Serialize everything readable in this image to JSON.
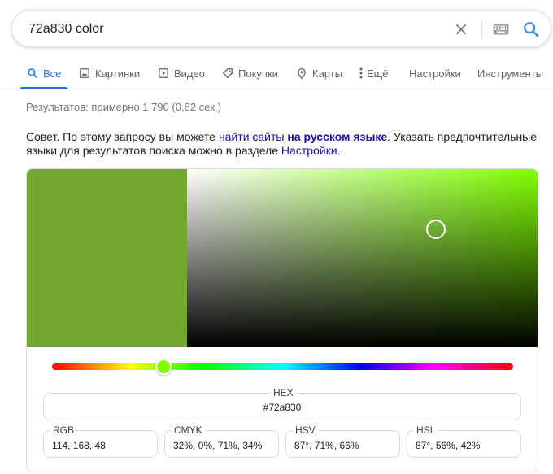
{
  "search": {
    "query": "72a830 color"
  },
  "tabs": [
    {
      "label": "Все",
      "icon": "search-icon",
      "active": true
    },
    {
      "label": "Картинки",
      "icon": "image-icon"
    },
    {
      "label": "Видео",
      "icon": "play-icon"
    },
    {
      "label": "Покупки",
      "icon": "tag-icon"
    },
    {
      "label": "Карты",
      "icon": "map-pin-icon"
    },
    {
      "label": "Ещё",
      "icon": "more-vert-icon"
    },
    {
      "label": "Настройки"
    },
    {
      "label": "Инструменты"
    }
  ],
  "stats": "Результатов: примерно 1 790 (0,82 сек.)",
  "tip": {
    "prefix": "Совет. По этому запросу вы можете ",
    "link1": "найти сайты",
    "space": " ",
    "link2": "на русском языке",
    "middle": ". Указать предпочтительные языки для результатов поиска можно в разделе ",
    "link3": "Настройки",
    "suffix": "."
  },
  "picker": {
    "color": "#72a830",
    "hue_color": "#80ff00",
    "saturation": 0.71,
    "value": 0.66,
    "hue_fraction": 0.242,
    "hex": {
      "label": "HEX",
      "value": "#72a830"
    },
    "fields": [
      {
        "label": "RGB",
        "value": "114, 168, 48"
      },
      {
        "label": "CMYK",
        "value": "32%, 0%, 71%, 34%"
      },
      {
        "label": "HSV",
        "value": "87°, 71%, 66%"
      },
      {
        "label": "HSL",
        "value": "87°, 56%, 42%"
      }
    ]
  },
  "colors": {
    "accent": "#1a73e8",
    "link": "#1a0dab",
    "text_secondary": "#5f6368"
  }
}
